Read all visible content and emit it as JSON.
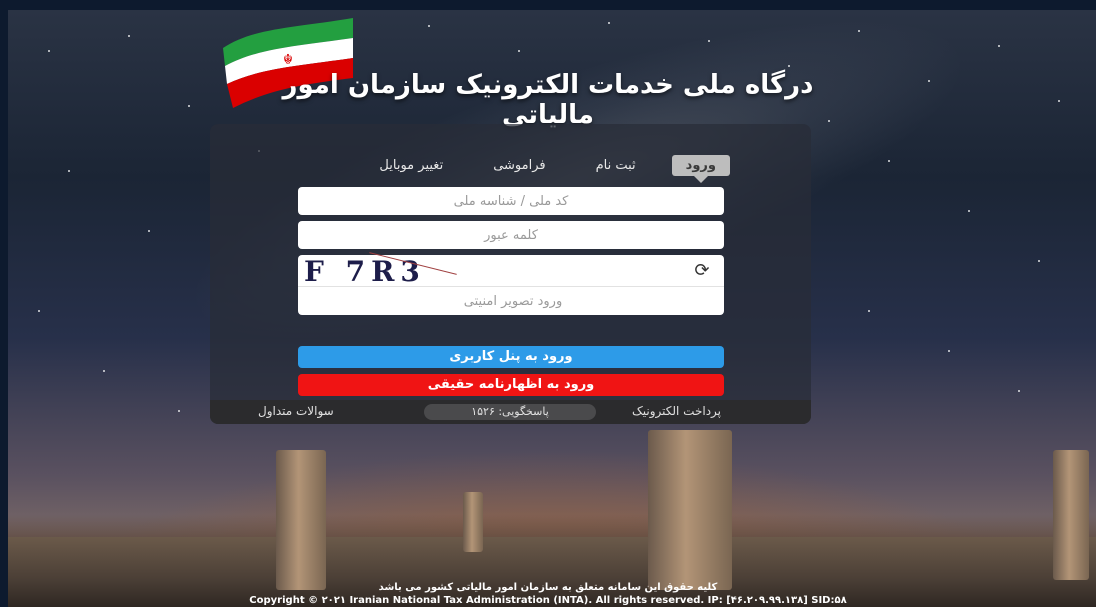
{
  "header": {
    "title": "درگاه ملی خدمات الکترونیک سازمان امور مالیاتی",
    "flag_icon": "iran-flag-icon",
    "colors": {
      "green": "#239f40",
      "white": "#ffffff",
      "red": "#da0000"
    }
  },
  "tabs": [
    {
      "label": "ورود",
      "active": true
    },
    {
      "label": "ثبت نام",
      "active": false
    },
    {
      "label": "فراموشی",
      "active": false
    },
    {
      "label": "تغییر موبایل",
      "active": false
    }
  ],
  "form": {
    "national_id_placeholder": "کد ملی / شناسه ملی",
    "password_placeholder": "کلمه عبور",
    "captcha_text": "F 7R3",
    "captcha_refresh_icon": "refresh-icon",
    "captcha_placeholder": "ورود تصویر امنیتی",
    "login_button": "ورود به پنل کاربری",
    "declaration_button": "ورود به اظهارنامه حقیقی",
    "colors": {
      "login": "#2d9be8",
      "declaration": "#f01414"
    }
  },
  "footer_bar": {
    "electronic_payment": "پرداخت الکترونیک",
    "support": "پاسخگویی: ۱۵۲۶",
    "faq": "سوالات متداول"
  },
  "copyright": {
    "line1": "کلیه حقوق این سامانه متعلق به سازمان امور مالیاتی کشور می باشد",
    "line2": "Copyright © ۲۰۲۱ Iranian National Tax Administration (INTA). All rights reserved. IP: [۴۶.۲۰۹.۹۹.۱۳۸] SID:۵۸"
  }
}
